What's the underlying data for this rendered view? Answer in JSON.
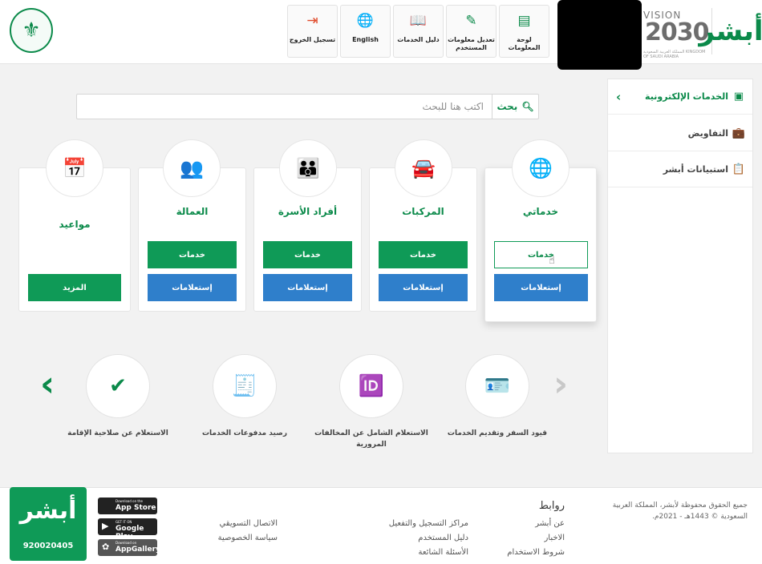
{
  "header": {
    "vision_title": "VISION",
    "vision_year": "2030",
    "vision_sub": "المملكة العربية السعودية KINGDOM OF SAUDI ARABIA",
    "logo_text": "أبشر",
    "toolbar": [
      {
        "label": "لوحة المعلومات",
        "icon": "dashboard-icon"
      },
      {
        "label": "تعديل معلومات المستخدم",
        "icon": "edit-icon"
      },
      {
        "label": "دليل الخدمات",
        "icon": "book-icon"
      },
      {
        "label": "English",
        "icon": "globe-icon"
      },
      {
        "label": "تسجيل الخروج",
        "icon": "logout-icon"
      }
    ]
  },
  "sidebar": {
    "items": [
      {
        "label": "الخدمات الإلكترونية",
        "icon": "services-icon",
        "active": true
      },
      {
        "label": "التفاويض",
        "icon": "briefcase-icon",
        "active": false
      },
      {
        "label": "استبيانات أبشر",
        "icon": "survey-icon",
        "active": false
      }
    ]
  },
  "search": {
    "placeholder": "اكتب هنا للبحث",
    "button": "بحث"
  },
  "cards": [
    {
      "title": "خدماتي",
      "icon": "globe-cursor-icon",
      "services": "خدمات",
      "inquiries": "إستعلامات"
    },
    {
      "title": "المركبات",
      "icon": "vehicle-icon",
      "services": "خدمات",
      "inquiries": "إستعلامات"
    },
    {
      "title": "أفراد الأسرة",
      "icon": "family-icon",
      "services": "خدمات",
      "inquiries": "إستعلامات"
    },
    {
      "title": "العمالة",
      "icon": "workers-icon",
      "services": "خدمات",
      "inquiries": "إستعلامات"
    },
    {
      "title": "مواعيد",
      "icon": "calendar-icon",
      "more": "المزيد"
    }
  ],
  "quick": [
    {
      "label": "قيود السفر وتقديم الخدمات",
      "icon": "travel-id-icon"
    },
    {
      "label": "الاستعلام الشامل عن المخالفات المرورية",
      "icon": "id-card-icon"
    },
    {
      "label": "رصيد مدفوعات الخدمات",
      "icon": "payment-doc-icon"
    },
    {
      "label": "الاستعلام عن صلاحية الإقامة",
      "icon": "residence-check-icon"
    }
  ],
  "footer": {
    "phone": "920020405",
    "logo_text": "أبشر",
    "stores": [
      {
        "small": "Download on the",
        "big": "App Store"
      },
      {
        "small": "GET IT ON",
        "big": "Google Play"
      },
      {
        "small": "Download on",
        "big": "AppGallery"
      }
    ],
    "links_title": "روابط",
    "links_col1": [
      "عن أبشر",
      "الاخبار",
      "شروط الاستخدام"
    ],
    "links_col2": [
      "مراكز التسجيل والتفعيل",
      "دليل المستخدم",
      "الأسئلة الشائعة"
    ],
    "links_col3": [
      "الاتصال التسويقي",
      "سياسة الخصوصية"
    ],
    "copyright": "جميع الحقوق محفوظة لأبشر، المملكة العربية السعودية © 1443هـ - 2021م."
  }
}
